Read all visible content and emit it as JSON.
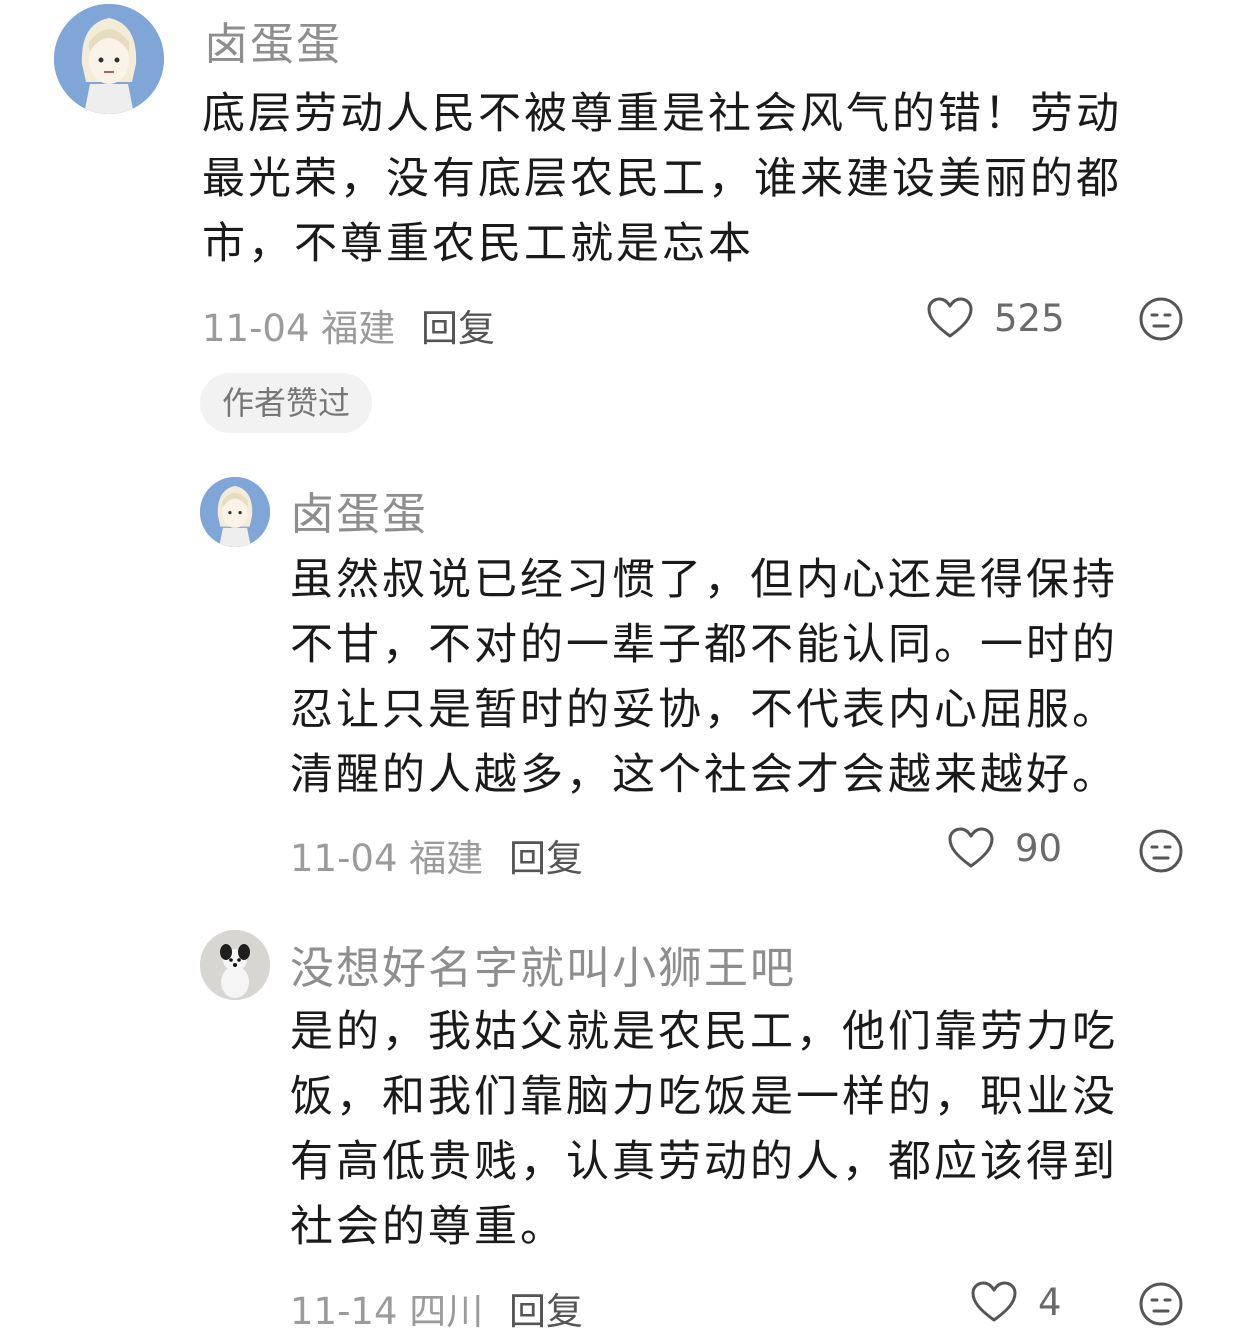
{
  "comments": [
    {
      "user": "卤蛋蛋",
      "lines": [
        "底层劳动人民不被尊重是社会风气的错！劳动",
        "最光荣，没有底层农民工，谁来建设美丽的都",
        "市，不尊重农民工就是忘本"
      ],
      "date": "11-04",
      "location": "福建",
      "reply_label": "回复",
      "likes": "525",
      "badge": "作者赞过"
    },
    {
      "user": "卤蛋蛋",
      "lines": [
        "虽然叔说已经习惯了，但内心还是得保持",
        "不甘，不对的一辈子都不能认同。一时的",
        "忍让只是暂时的妥协，不代表内心屈服。",
        "清醒的人越多，这个社会才会越来越好。"
      ],
      "date": "11-04",
      "location": "福建",
      "reply_label": "回复",
      "likes": "90"
    },
    {
      "user": "没想好名字就叫小狮王吧",
      "lines": [
        "是的，我姑父就是农民工，他们靠劳力吃",
        "饭，和我们靠脑力吃饭是一样的，职业没",
        "有高低贵贱，认真劳动的人，都应该得到",
        "社会的尊重。"
      ],
      "date": "11-14",
      "location": "四川",
      "reply_label": "回复",
      "likes": "4"
    }
  ],
  "icons": {
    "like": "heart-outline-icon",
    "emoji": "neutral-face-icon"
  }
}
